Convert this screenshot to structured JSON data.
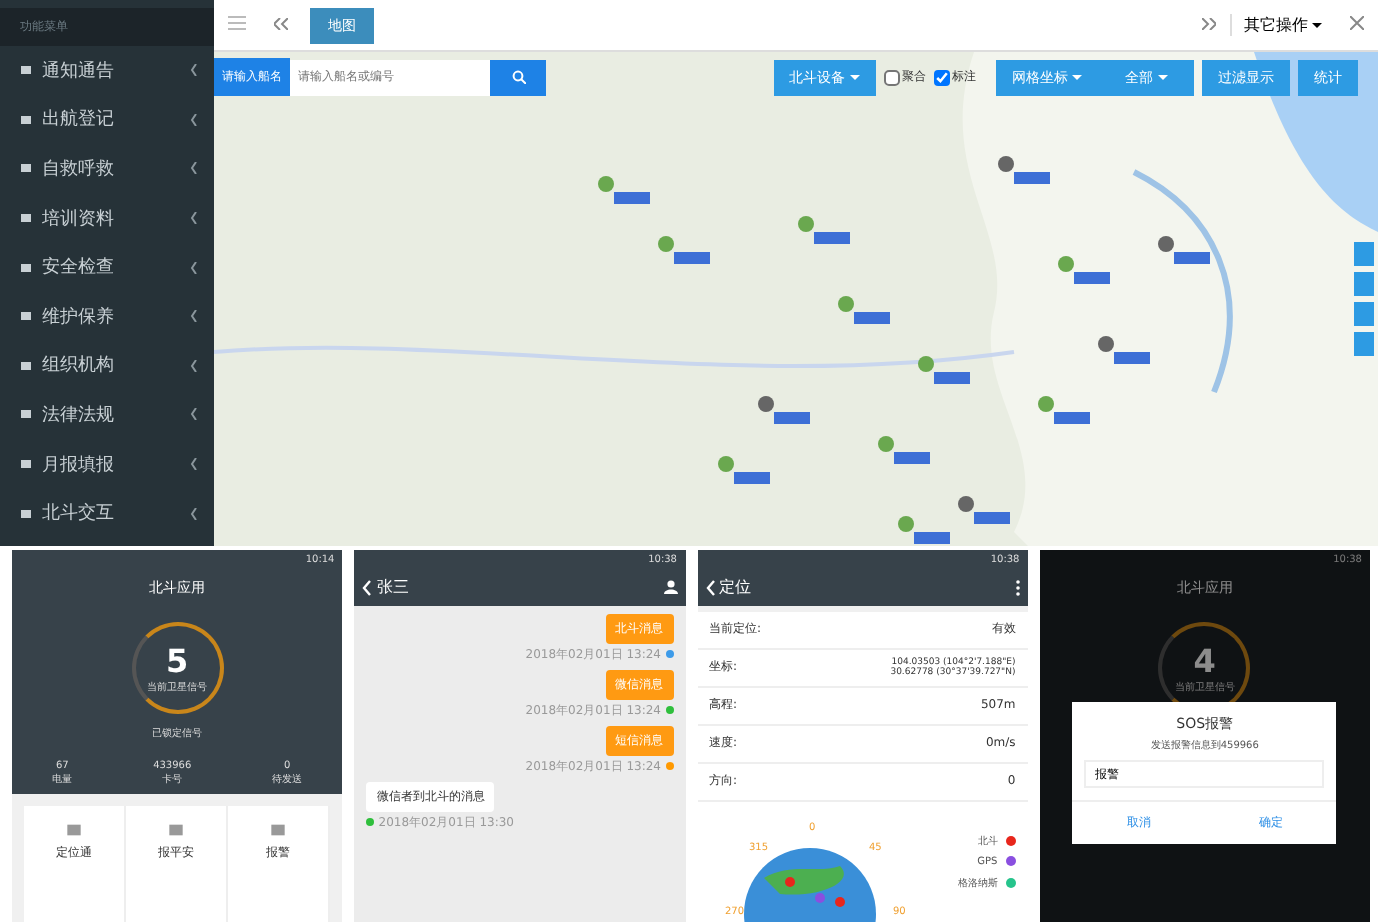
{
  "web": {
    "sidebar": {
      "title": "功能菜单",
      "items": [
        {
          "label": "通知通告",
          "expanded": false
        },
        {
          "label": "出航登记",
          "expanded": false
        },
        {
          "label": "自救呼救",
          "expanded": false
        },
        {
          "label": "培训资料",
          "expanded": false
        },
        {
          "label": "安全检查",
          "expanded": false
        },
        {
          "label": "维护保养",
          "expanded": false
        },
        {
          "label": "组织机构",
          "expanded": false
        },
        {
          "label": "法律法规",
          "expanded": false
        },
        {
          "label": "月报填报",
          "expanded": false
        },
        {
          "label": "北斗交互",
          "expanded": false
        }
      ]
    },
    "tabs": [
      {
        "label": "地图",
        "selected": true
      }
    ],
    "more_menu": "其它操作",
    "search": {
      "label": "请输入船名",
      "placeholder": "请输入船名或编号"
    },
    "device_button": "北斗设备",
    "checks": [
      {
        "label": "聚合",
        "checked": false
      },
      {
        "label": "标注",
        "checked": true
      }
    ],
    "grid_button": "网格坐标",
    "all_button": "全部",
    "filter_button": "过滤显示",
    "stats_button": "统计"
  },
  "phones": [
    {
      "kind": "home",
      "time": "10:14",
      "title": "北斗应用",
      "count": "5",
      "count_label": "当前卫星信号",
      "status": "已锁定信号",
      "stats": [
        {
          "value": "67",
          "label": "电量"
        },
        {
          "value": "433966",
          "label": "卡号"
        },
        {
          "value": "0",
          "label": "待发送"
        }
      ],
      "tiles": [
        "定位通",
        "报平安",
        "报警"
      ]
    },
    {
      "kind": "chat",
      "time": "10:38",
      "title": "张三",
      "messages": [
        {
          "text": "北斗消息",
          "time": "2018年02月01日 13:24",
          "outgoing": true,
          "color": "#3d9be9"
        },
        {
          "text": "微信消息",
          "time": "2018年02月01日 13:24",
          "outgoing": true,
          "color": "#2fbf3c"
        },
        {
          "text": "短信消息",
          "time": "2018年02月01日 13:24",
          "outgoing": true,
          "color": "#ff9900"
        },
        {
          "text": "微信者到北斗的消息",
          "time": "2018年02月01日 13:30",
          "outgoing": false,
          "color": "#2fbf3c"
        }
      ]
    },
    {
      "kind": "location",
      "time": "10:38",
      "title": "定位",
      "rows": [
        {
          "label": "当前定位:",
          "value": "有效"
        },
        {
          "label": "坐标:",
          "value": "104.03503 (104°2'7.188\"E)",
          "value2": "30.62778 (30°37'39.727\"N)"
        },
        {
          "label": "高程:",
          "value": "507m"
        },
        {
          "label": "速度:",
          "value": "0m/s"
        },
        {
          "label": "方向:",
          "value": "0"
        }
      ],
      "angles": [
        "0",
        "45",
        "90",
        "270",
        "315"
      ],
      "legend": [
        {
          "label": "北斗",
          "color": "#e8261c"
        },
        {
          "label": "GPS",
          "color": "#8a4fe0"
        },
        {
          "label": "格洛纳斯",
          "color": "#26c48c"
        }
      ]
    },
    {
      "kind": "sos",
      "time": "10:38",
      "title": "北斗应用",
      "count": "4",
      "count_label": "当前卫星信号",
      "dialog": {
        "title": "SOS报警",
        "message": "发送报警信息到459966",
        "field": "报警",
        "cancel": "取消",
        "ok": "确定"
      }
    }
  ]
}
